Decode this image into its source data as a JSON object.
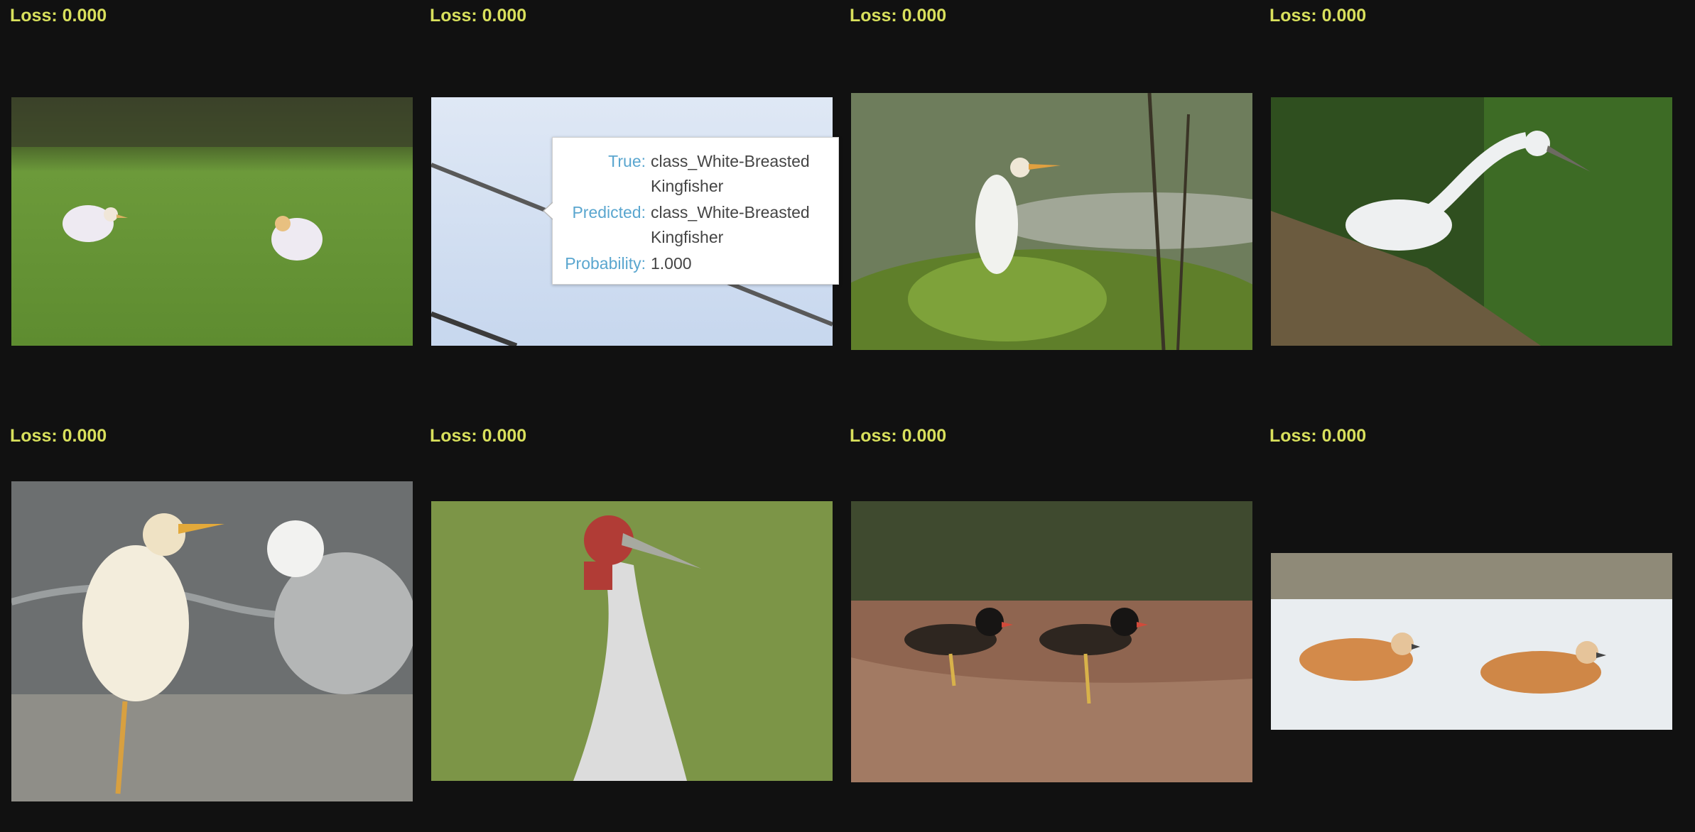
{
  "cards": [
    {
      "loss": "Loss: 0.000",
      "scene": "two-egrets-on-grass"
    },
    {
      "loss": "Loss: 0.000",
      "scene": "kingfisher-sky-wires"
    },
    {
      "loss": "Loss: 0.000",
      "scene": "egret-on-shrub"
    },
    {
      "loss": "Loss: 0.000",
      "scene": "heron-reeds"
    },
    {
      "loss": "Loss: 0.000",
      "scene": "egret-and-gull"
    },
    {
      "loss": "Loss: 0.000",
      "scene": "sarus-crane"
    },
    {
      "loss": "Loss: 0.000",
      "scene": "red-wattled-lapwings"
    },
    {
      "loss": "Loss: 0.000",
      "scene": "ruddy-shelducks"
    }
  ],
  "tooltip": {
    "true_label": "True:",
    "true_value": "class_White-Breasted Kingfisher",
    "predicted_label": "Predicted:",
    "predicted_value": "class_White-Breasted Kingfisher",
    "probability_label": "Probability:",
    "probability_value": "1.000"
  }
}
